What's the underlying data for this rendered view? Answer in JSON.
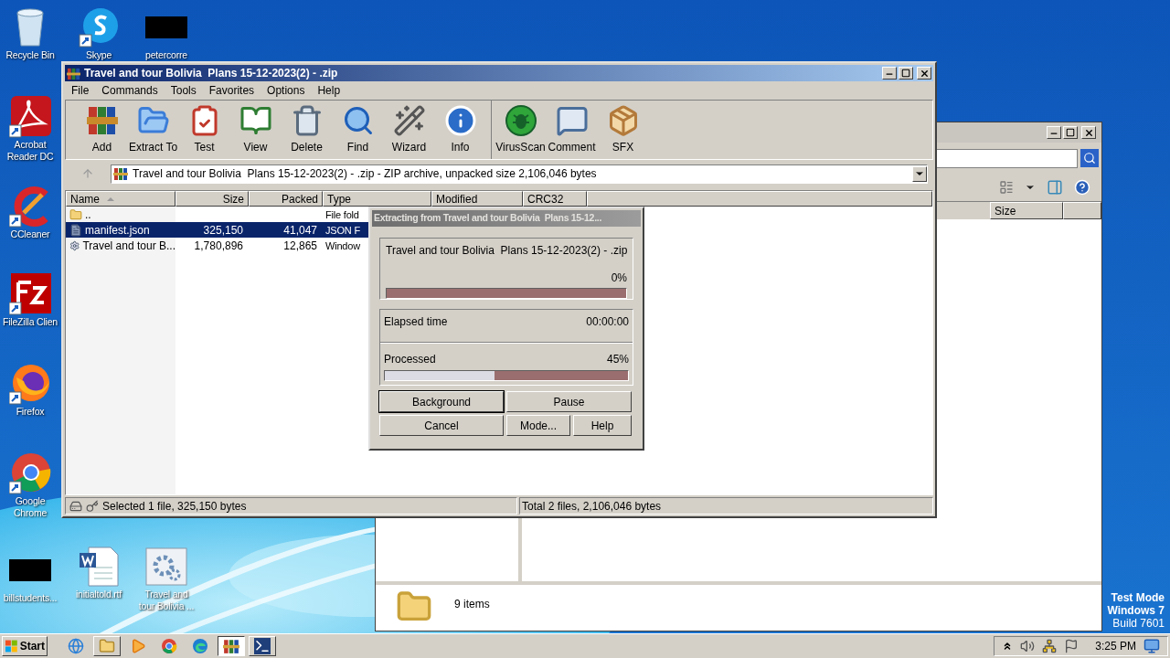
{
  "desktop_icons": [
    {
      "kind": "recycle",
      "label": "Recycle Bin"
    },
    {
      "kind": "skype",
      "label": "Skype"
    },
    {
      "kind": "redacted",
      "label": "petercorre"
    },
    {
      "kind": "acrobat",
      "label": "Acrobat Reader DC"
    },
    {
      "kind": "ccleaner",
      "label": "CCleaner"
    },
    {
      "kind": "filezilla",
      "label": "FileZilla Clien"
    },
    {
      "kind": "firefox",
      "label": "Firefox"
    },
    {
      "kind": "chrome",
      "label": "Google Chrome"
    },
    {
      "kind": "redacted",
      "label": "billstudents..."
    },
    {
      "kind": "document",
      "label": "initialtold.rtf"
    },
    {
      "kind": "setup",
      "label": "Travel and tour Bolivia ..."
    }
  ],
  "explorer": {
    "column": "Size",
    "details": "9 items"
  },
  "winrar": {
    "title": "Travel and tour Bolivia  Plans 15-12-2023(2) - .zip",
    "menu": [
      "File",
      "Commands",
      "Tools",
      "Favorites",
      "Options",
      "Help"
    ],
    "toolbar": [
      [
        {
          "kind": "add",
          "label": "Add"
        },
        {
          "kind": "extract",
          "label": "Extract To"
        },
        {
          "kind": "test",
          "label": "Test"
        },
        {
          "kind": "view",
          "label": "View"
        },
        {
          "kind": "delete",
          "label": "Delete"
        },
        {
          "kind": "find",
          "label": "Find"
        },
        {
          "kind": "wizard",
          "label": "Wizard"
        },
        {
          "kind": "info",
          "label": "Info"
        }
      ],
      [
        {
          "kind": "virusscan",
          "label": "VirusScan"
        },
        {
          "kind": "comment",
          "label": "Comment"
        },
        {
          "kind": "sfx",
          "label": "SFX"
        }
      ]
    ],
    "address": "Travel and tour Bolivia  Plans 15-12-2023(2) - .zip - ZIP archive, unpacked size 2,106,046 bytes",
    "columns": [
      "Name",
      "Size",
      "Packed",
      "Type",
      "Modified",
      "CRC32"
    ],
    "rows": [
      {
        "kind": "folder",
        "name": "..",
        "type": "File fold",
        "selected": false
      },
      {
        "kind": "file",
        "name": "manifest.json",
        "size": "325,150",
        "packed": "41,047",
        "type": "JSON F",
        "selected": true
      },
      {
        "kind": "setup",
        "name": "Travel and tour B...",
        "size": "1,780,896",
        "packed": "12,865",
        "type": "Window",
        "selected": false
      }
    ],
    "status_left": "Selected 1 file, 325,150 bytes",
    "status_right": "Total 2 files, 2,106,046 bytes"
  },
  "dialog": {
    "title": "Extracting from Travel and tour Bolivia  Plans 15-12...",
    "archive": "Travel and tour Bolivia  Plans 15-12-2023(2) - .zip",
    "archive_percent": "0%",
    "archive_progress": {
      "level": 0
    },
    "elapsed_label": "Elapsed time",
    "elapsed": "00:00:00",
    "processed_label": "Processed",
    "processed_percent": "45%",
    "processed_progress": {
      "level": 0.45
    },
    "buttons": [
      {
        "label": "Background",
        "default": true
      },
      {
        "label": "Pause",
        "default": false
      },
      {
        "label": "Cancel",
        "default": false
      },
      {
        "label": "Mode...",
        "default": false
      },
      {
        "label": "Help",
        "default": false
      }
    ]
  },
  "test_mode": [
    "Test Mode",
    "Windows 7",
    "Build 7601"
  ],
  "taskbar": {
    "start": "Start",
    "apps": [
      {
        "kind": "ie",
        "running": false,
        "active": false
      },
      {
        "kind": "explorer",
        "running": true,
        "active": false
      },
      {
        "kind": "media",
        "running": false,
        "active": false
      },
      {
        "kind": "chrome",
        "running": false,
        "active": false
      },
      {
        "kind": "edge",
        "running": false,
        "active": false
      },
      {
        "kind": "winrar",
        "running": true,
        "active": true
      },
      {
        "kind": "powershell",
        "running": true,
        "active": false
      }
    ],
    "clock": "3:25 PM"
  }
}
